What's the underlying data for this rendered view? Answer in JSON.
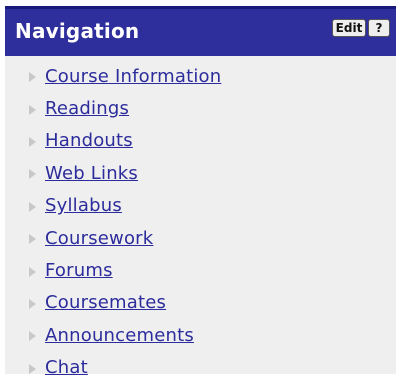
{
  "header": {
    "title": "Navigation",
    "edit_label": "Edit",
    "help_label": "?"
  },
  "nav": {
    "items": [
      {
        "label": "Course Information"
      },
      {
        "label": "Readings"
      },
      {
        "label": "Handouts"
      },
      {
        "label": "Web Links"
      },
      {
        "label": "Syllabus"
      },
      {
        "label": "Coursework"
      },
      {
        "label": "Forums"
      },
      {
        "label": "Coursemates"
      },
      {
        "label": "Announcements"
      },
      {
        "label": "Chat"
      }
    ]
  },
  "colors": {
    "header_bg": "#2e2e9c",
    "body_bg": "#efefef",
    "link": "#2c2c9c",
    "arrow": "#c8c8c8"
  },
  "icons": {
    "bullet": "triangle-right-icon"
  }
}
